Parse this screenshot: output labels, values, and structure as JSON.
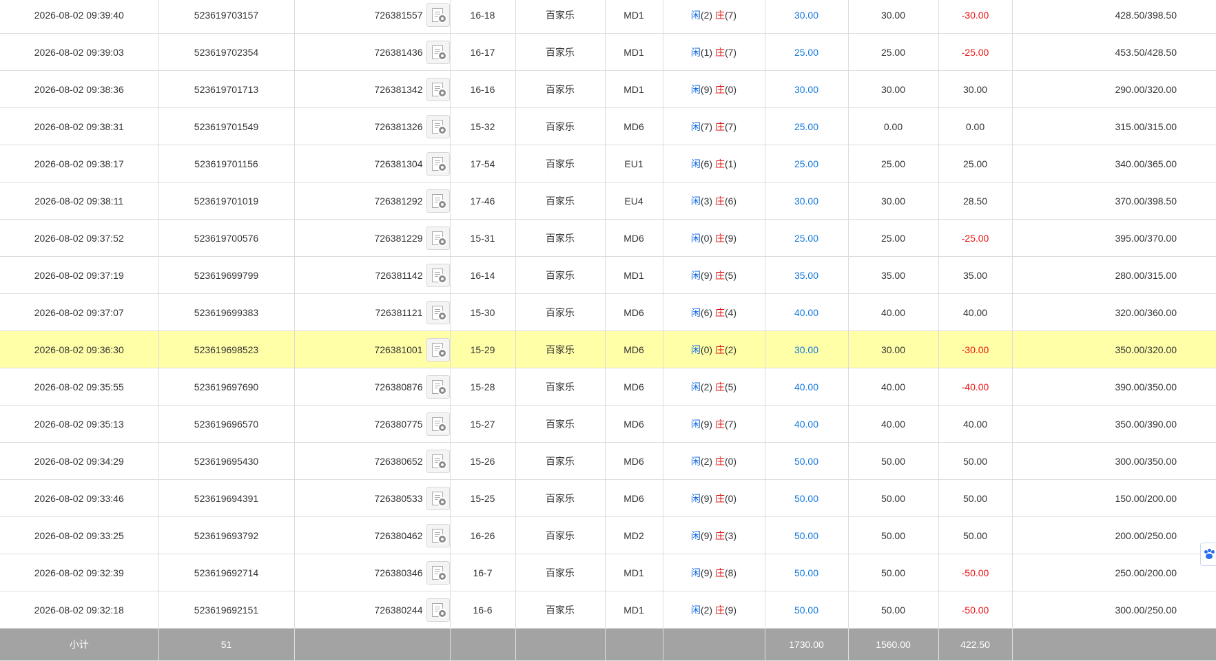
{
  "rows": [
    {
      "time": "2026-08-02 09:39:40",
      "bet_id": "523619703157",
      "table_id": "726381557",
      "shoe": "16-18",
      "game": "百家乐",
      "room": "MD1",
      "player": "闲",
      "player_pts": "(2)",
      "banker": "庄",
      "banker_pts": "(7)",
      "bet": "30.00",
      "valid": "30.00",
      "winloss": "-30.00",
      "balance": "428.50/398.50",
      "highlight": false
    },
    {
      "time": "2026-08-02 09:39:03",
      "bet_id": "523619702354",
      "table_id": "726381436",
      "shoe": "16-17",
      "game": "百家乐",
      "room": "MD1",
      "player": "闲",
      "player_pts": "(1)",
      "banker": "庄",
      "banker_pts": "(7)",
      "bet": "25.00",
      "valid": "25.00",
      "winloss": "-25.00",
      "balance": "453.50/428.50",
      "highlight": false
    },
    {
      "time": "2026-08-02 09:38:36",
      "bet_id": "523619701713",
      "table_id": "726381342",
      "shoe": "16-16",
      "game": "百家乐",
      "room": "MD1",
      "player": "闲",
      "player_pts": "(9)",
      "banker": "庄",
      "banker_pts": "(0)",
      "bet": "30.00",
      "valid": "30.00",
      "winloss": "30.00",
      "balance": "290.00/320.00",
      "highlight": false
    },
    {
      "time": "2026-08-02 09:38:31",
      "bet_id": "523619701549",
      "table_id": "726381326",
      "shoe": "15-32",
      "game": "百家乐",
      "room": "MD6",
      "player": "闲",
      "player_pts": "(7)",
      "banker": "庄",
      "banker_pts": "(7)",
      "bet": "25.00",
      "valid": "0.00",
      "winloss": "0.00",
      "balance": "315.00/315.00",
      "highlight": false
    },
    {
      "time": "2026-08-02 09:38:17",
      "bet_id": "523619701156",
      "table_id": "726381304",
      "shoe": "17-54",
      "game": "百家乐",
      "room": "EU1",
      "player": "闲",
      "player_pts": "(6)",
      "banker": "庄",
      "banker_pts": "(1)",
      "bet": "25.00",
      "valid": "25.00",
      "winloss": "25.00",
      "balance": "340.00/365.00",
      "highlight": false
    },
    {
      "time": "2026-08-02 09:38:11",
      "bet_id": "523619701019",
      "table_id": "726381292",
      "shoe": "17-46",
      "game": "百家乐",
      "room": "EU4",
      "player": "闲",
      "player_pts": "(3)",
      "banker": "庄",
      "banker_pts": "(6)",
      "bet": "30.00",
      "valid": "30.00",
      "winloss": "28.50",
      "balance": "370.00/398.50",
      "highlight": false
    },
    {
      "time": "2026-08-02 09:37:52",
      "bet_id": "523619700576",
      "table_id": "726381229",
      "shoe": "15-31",
      "game": "百家乐",
      "room": "MD6",
      "player": "闲",
      "player_pts": "(0)",
      "banker": "庄",
      "banker_pts": "(9)",
      "bet": "25.00",
      "valid": "25.00",
      "winloss": "-25.00",
      "balance": "395.00/370.00",
      "highlight": false
    },
    {
      "time": "2026-08-02 09:37:19",
      "bet_id": "523619699799",
      "table_id": "726381142",
      "shoe": "16-14",
      "game": "百家乐",
      "room": "MD1",
      "player": "闲",
      "player_pts": "(9)",
      "banker": "庄",
      "banker_pts": "(5)",
      "bet": "35.00",
      "valid": "35.00",
      "winloss": "35.00",
      "balance": "280.00/315.00",
      "highlight": false
    },
    {
      "time": "2026-08-02 09:37:07",
      "bet_id": "523619699383",
      "table_id": "726381121",
      "shoe": "15-30",
      "game": "百家乐",
      "room": "MD6",
      "player": "闲",
      "player_pts": "(6)",
      "banker": "庄",
      "banker_pts": "(4)",
      "bet": "40.00",
      "valid": "40.00",
      "winloss": "40.00",
      "balance": "320.00/360.00",
      "highlight": false
    },
    {
      "time": "2026-08-02 09:36:30",
      "bet_id": "523619698523",
      "table_id": "726381001",
      "shoe": "15-29",
      "game": "百家乐",
      "room": "MD6",
      "player": "闲",
      "player_pts": "(0)",
      "banker": "庄",
      "banker_pts": "(2)",
      "bet": "30.00",
      "valid": "30.00",
      "winloss": "-30.00",
      "balance": "350.00/320.00",
      "highlight": true
    },
    {
      "time": "2026-08-02 09:35:55",
      "bet_id": "523619697690",
      "table_id": "726380876",
      "shoe": "15-28",
      "game": "百家乐",
      "room": "MD6",
      "player": "闲",
      "player_pts": "(2)",
      "banker": "庄",
      "banker_pts": "(5)",
      "bet": "40.00",
      "valid": "40.00",
      "winloss": "-40.00",
      "balance": "390.00/350.00",
      "highlight": false
    },
    {
      "time": "2026-08-02 09:35:13",
      "bet_id": "523619696570",
      "table_id": "726380775",
      "shoe": "15-27",
      "game": "百家乐",
      "room": "MD6",
      "player": "闲",
      "player_pts": "(9)",
      "banker": "庄",
      "banker_pts": "(7)",
      "bet": "40.00",
      "valid": "40.00",
      "winloss": "40.00",
      "balance": "350.00/390.00",
      "highlight": false
    },
    {
      "time": "2026-08-02 09:34:29",
      "bet_id": "523619695430",
      "table_id": "726380652",
      "shoe": "15-26",
      "game": "百家乐",
      "room": "MD6",
      "player": "闲",
      "player_pts": "(2)",
      "banker": "庄",
      "banker_pts": "(0)",
      "bet": "50.00",
      "valid": "50.00",
      "winloss": "50.00",
      "balance": "300.00/350.00",
      "highlight": false
    },
    {
      "time": "2026-08-02 09:33:46",
      "bet_id": "523619694391",
      "table_id": "726380533",
      "shoe": "15-25",
      "game": "百家乐",
      "room": "MD6",
      "player": "闲",
      "player_pts": "(9)",
      "banker": "庄",
      "banker_pts": "(0)",
      "bet": "50.00",
      "valid": "50.00",
      "winloss": "50.00",
      "balance": "150.00/200.00",
      "highlight": false
    },
    {
      "time": "2026-08-02 09:33:25",
      "bet_id": "523619693792",
      "table_id": "726380462",
      "shoe": "16-26",
      "game": "百家乐",
      "room": "MD2",
      "player": "闲",
      "player_pts": "(9)",
      "banker": "庄",
      "banker_pts": "(3)",
      "bet": "50.00",
      "valid": "50.00",
      "winloss": "50.00",
      "balance": "200.00/250.00",
      "highlight": false
    },
    {
      "time": "2026-08-02 09:32:39",
      "bet_id": "523619692714",
      "table_id": "726380346",
      "shoe": "16-7",
      "game": "百家乐",
      "room": "MD1",
      "player": "闲",
      "player_pts": "(9)",
      "banker": "庄",
      "banker_pts": "(8)",
      "bet": "50.00",
      "valid": "50.00",
      "winloss": "-50.00",
      "balance": "250.00/200.00",
      "highlight": false
    },
    {
      "time": "2026-08-02 09:32:18",
      "bet_id": "523619692151",
      "table_id": "726380244",
      "shoe": "16-6",
      "game": "百家乐",
      "room": "MD1",
      "player": "闲",
      "player_pts": "(2)",
      "banker": "庄",
      "banker_pts": "(9)",
      "bet": "50.00",
      "valid": "50.00",
      "winloss": "-50.00",
      "balance": "300.00/250.00",
      "highlight": false
    }
  ],
  "subtotal": {
    "label": "小计",
    "count": "51",
    "bet_total": "1730.00",
    "valid_total": "1560.00",
    "winloss_total": "422.50"
  },
  "colors": {
    "highlight_row": "#ffffa8",
    "subtotal_bg": "#a3a3a3",
    "bet_blue": "#1177dd",
    "loss_red": "#ee1111",
    "player_blue": "#1166dd",
    "banker_red": "#dd1111"
  },
  "icons": {
    "game_record": "game-record-icon",
    "side_widget": "paw-icon"
  }
}
